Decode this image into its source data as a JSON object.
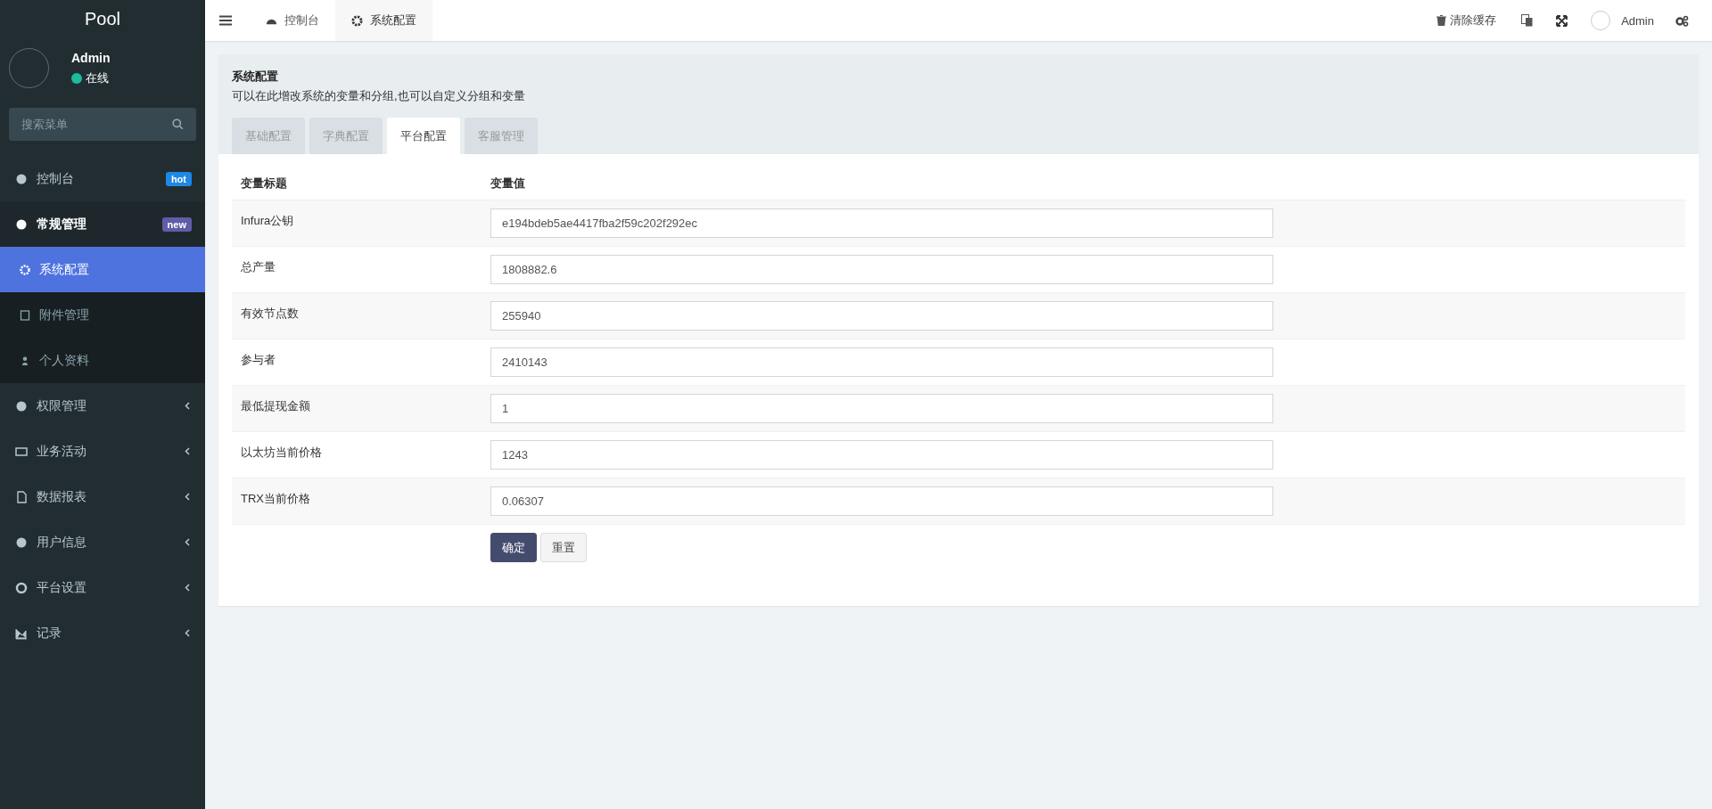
{
  "sidebar": {
    "logo": "Pool",
    "user": {
      "name": "Admin",
      "status": "在线"
    },
    "search": {
      "placeholder": "搜索菜单"
    },
    "menu": [
      {
        "kind": "link",
        "label": "控制台",
        "selected": false,
        "badge": {
          "text": "hot",
          "color": "#1e88e5"
        }
      },
      {
        "kind": "group",
        "label": "常规管理",
        "selected": false,
        "expanded": true,
        "badge": {
          "text": "new",
          "color": "#605ca8"
        },
        "children": [
          {
            "label": "系统配置",
            "selected": true
          },
          {
            "label": "附件管理",
            "selected": false
          },
          {
            "label": "个人资料",
            "selected": false
          }
        ]
      },
      {
        "kind": "group",
        "label": "权限管理",
        "selected": false,
        "expanded": false
      },
      {
        "kind": "group",
        "label": "业务活动",
        "selected": false,
        "expanded": false
      },
      {
        "kind": "group",
        "label": "数据报表",
        "selected": false,
        "expanded": false
      },
      {
        "kind": "group",
        "label": "用户信息",
        "selected": false,
        "expanded": false
      },
      {
        "kind": "group",
        "label": "平台设置",
        "selected": false,
        "expanded": false
      },
      {
        "kind": "group",
        "label": "记录",
        "selected": false,
        "expanded": false
      }
    ]
  },
  "topbar": {
    "tabs": [
      {
        "label": "控制台",
        "selected": false
      },
      {
        "label": "系统配置",
        "selected": true
      }
    ],
    "clear_cache": "清除缓存",
    "user": "Admin"
  },
  "panel": {
    "title": "系统配置",
    "description": "可以在此增改系统的变量和分组,也可以自定义分组和变量",
    "tabs": [
      {
        "label": "基础配置",
        "selected": false
      },
      {
        "label": "字典配置",
        "selected": false
      },
      {
        "label": "平台配置",
        "selected": true
      },
      {
        "label": "客服管理",
        "selected": false
      }
    ],
    "columns": [
      "变量标题",
      "变量值"
    ],
    "rows": [
      {
        "title": "Infura公钥",
        "value": "e194bdeb5ae4417fba2f59c202f292ec"
      },
      {
        "title": "总产量",
        "value": "1808882.6"
      },
      {
        "title": "有效节点数",
        "value": "255940"
      },
      {
        "title": "参与者",
        "value": "2410143"
      },
      {
        "title": "最低提现金额",
        "value": "1"
      },
      {
        "title": "以太坊当前价格",
        "value": "1243"
      },
      {
        "title": "TRX当前价格",
        "value": "0.06307"
      }
    ],
    "buttons": [
      {
        "kind": "primary",
        "label": "确定"
      },
      {
        "kind": "default",
        "label": "重置"
      }
    ]
  }
}
